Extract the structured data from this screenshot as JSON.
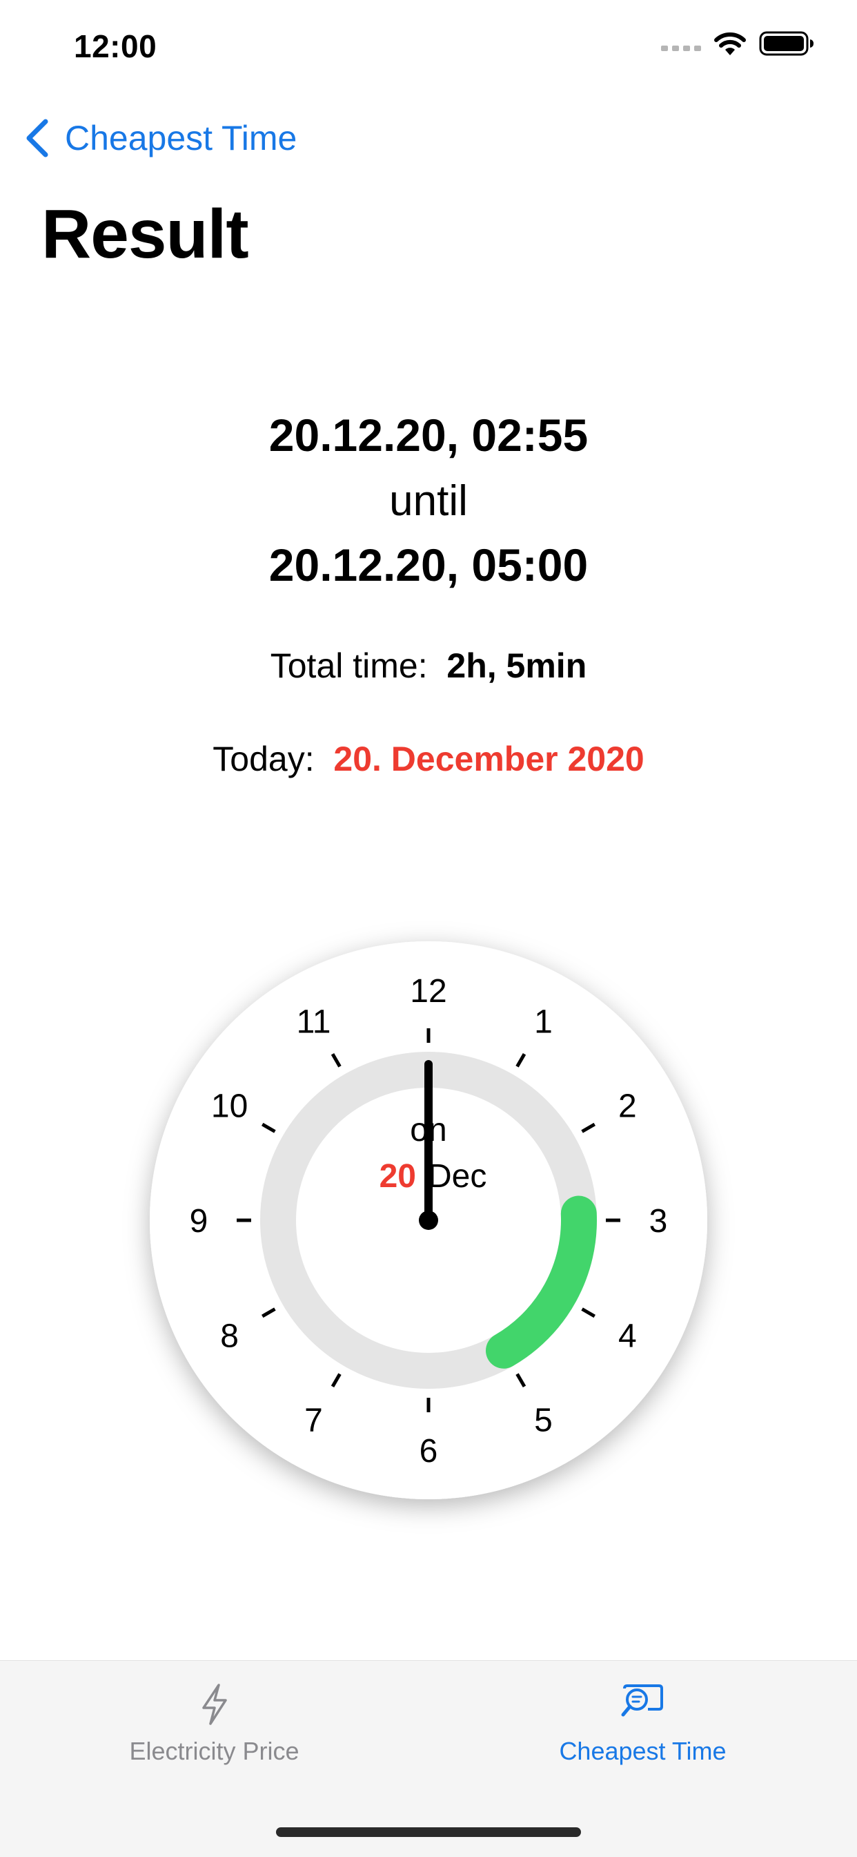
{
  "status_bar": {
    "time": "12:00"
  },
  "nav": {
    "back_label": "Cheapest Time"
  },
  "page": {
    "title": "Result"
  },
  "result": {
    "start": "20.12.20, 02:55",
    "until": "until",
    "end": "20.12.20, 05:00",
    "total_label": "Total time:",
    "total_value": "2h, 5min",
    "today_label": "Today:",
    "today_value": "20. December 2020"
  },
  "clock": {
    "numbers": [
      "12",
      "1",
      "2",
      "3",
      "4",
      "5",
      "6",
      "7",
      "8",
      "9",
      "10",
      "11"
    ],
    "center_on": "on",
    "center_day": "20",
    "center_month": "Dec",
    "hand_hour": 12,
    "arc_start_hour": 2.9167,
    "arc_end_hour": 5.0,
    "colors": {
      "arc": "#42d56b",
      "track": "#e5e5e5",
      "accent_red": "#ee3b30"
    }
  },
  "tab_bar": {
    "tabs": [
      {
        "label": "Electricity Price",
        "icon": "bolt-icon",
        "active": false
      },
      {
        "label": "Cheapest Time",
        "icon": "search-chat-icon",
        "active": true
      }
    ],
    "colors": {
      "active": "#1878e6",
      "inactive": "#8a8a8e"
    }
  }
}
